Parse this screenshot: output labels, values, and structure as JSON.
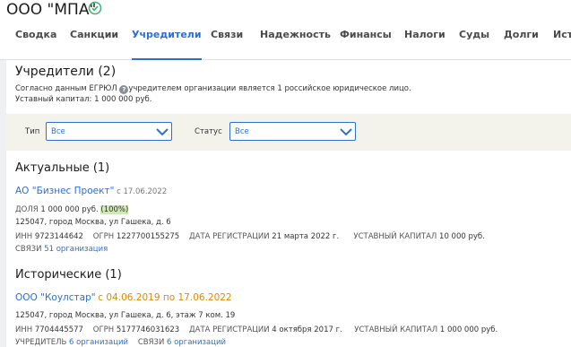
{
  "company": {
    "name": "ООО \"МПА\""
  },
  "tabs": [
    "Сводка",
    "Санкции",
    "Учредители",
    "Связи",
    "Надежность",
    "Финансы",
    "Налоги",
    "Суды",
    "Долги",
    "Исто"
  ],
  "founders": {
    "title": "Учредители (2)",
    "egrul_pre": "Согласно данным ЕГРЮЛ",
    "egrul_post": "учредителем организации является 1 российское юридическое лицо.",
    "capital": "Уставный капитал: 1 000 000 руб."
  },
  "filters": {
    "type_label": "Тип",
    "type_value": "Все",
    "status_label": "Статус",
    "status_value": "Все"
  },
  "actual": {
    "title": "Актуальные (1)",
    "name": "АО \"Бизнес Проект\"",
    "since": "с 17.06.2022",
    "share_label": "ДОЛЯ",
    "share_value": "1 000 000 руб.",
    "share_pct": "(100%)",
    "address": "125047, город Москва, ул Гашека, д. 6",
    "inn_label": "ИНН",
    "inn": "9723144642",
    "ogrn_label": "ОГРН",
    "ogrn": "1227700155275",
    "reg_label": "ДАТА РЕГИСТРАЦИИ",
    "reg": "21 марта 2022 г.",
    "cap_label": "УСТАВНЫЙ КАПИТАЛ",
    "cap": "10 000 руб.",
    "links_label": "СВЯЗИ",
    "links": "51 организация"
  },
  "historic": {
    "title": "Исторические (1)",
    "name": "ООО \"Коулстар\"",
    "period": "с 04.06.2019 по 17.06.2022",
    "address": "125047, город Москва, ул Гашека, д. 6, этаж 7 ком. 19",
    "inn_label": "ИНН",
    "inn": "7704445577",
    "ogrn_label": "ОГРН",
    "ogrn": "5177746031623",
    "reg_label": "ДАТА РЕГИСТРАЦИИ",
    "reg": "4 октября 2017 г.",
    "cap_label": "УСТАВНЫЙ КАПИТАЛ",
    "cap": "1 000 000 руб.",
    "founder_label": "УЧРЕДИТЕЛЬ",
    "founder": "6 организаций",
    "links_label": "СВЯЗИ",
    "links": "6 организаций"
  },
  "colors": {
    "accent": "#2e6fd0",
    "ok": "#3cb371",
    "orange": "#e08a00",
    "highlight": "#cfe8b5"
  }
}
